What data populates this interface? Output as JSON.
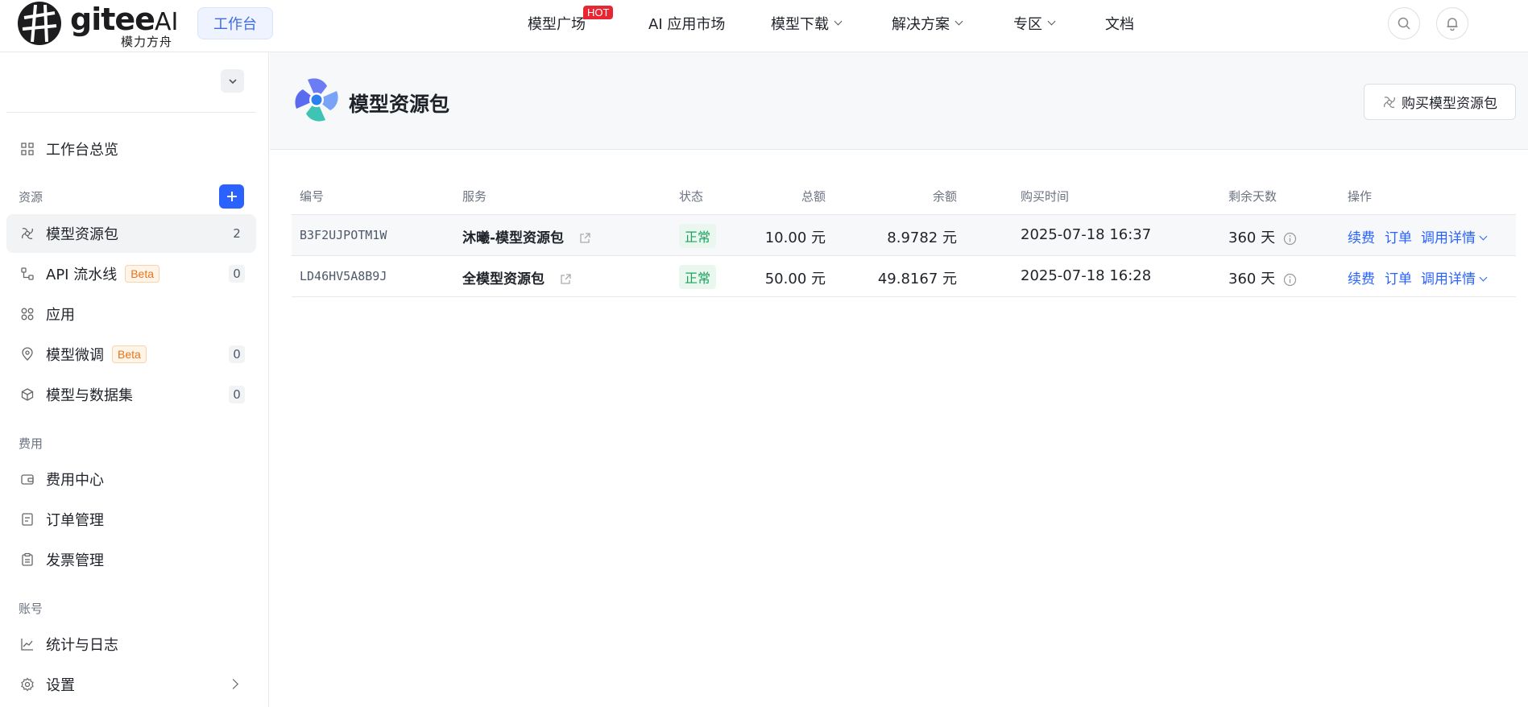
{
  "header": {
    "logo_text": "gitee",
    "logo_ai": "AI",
    "logo_subtitle": "模力方舟",
    "workspace_button": "工作台",
    "nav": [
      {
        "label": "模型广场",
        "badge": "HOT"
      },
      {
        "label": "AI 应用市场"
      },
      {
        "label": "模型下载",
        "dropdown": true
      },
      {
        "label": "解决方案",
        "dropdown": true
      },
      {
        "label": "专区",
        "dropdown": true
      },
      {
        "label": "文档"
      }
    ],
    "search_icon": "search-icon",
    "bell_icon": "bell-icon"
  },
  "sidebar": {
    "overview": "工作台总览",
    "sections": {
      "resources": "资源",
      "billing": "费用",
      "account": "账号"
    },
    "items": [
      {
        "label": "模型资源包",
        "count": "2",
        "icon": "pinwheel-icon"
      },
      {
        "label": "API 流水线",
        "badge": "Beta",
        "count": "0",
        "icon": "pipeline-icon"
      },
      {
        "label": "应用",
        "icon": "apps-icon"
      },
      {
        "label": "模型微调",
        "badge": "Beta",
        "count": "0",
        "icon": "location-pin-icon"
      },
      {
        "label": "模型与数据集",
        "count": "0",
        "icon": "cube-icon"
      },
      {
        "label": "费用中心",
        "icon": "wallet-icon"
      },
      {
        "label": "订单管理",
        "icon": "order-icon"
      },
      {
        "label": "发票管理",
        "icon": "invoice-icon"
      },
      {
        "label": "统计与日志",
        "icon": "chart-line-icon"
      },
      {
        "label": "设置",
        "icon": "gear-icon"
      }
    ]
  },
  "main": {
    "title": "模型资源包",
    "buy_button": "购买模型资源包",
    "table": {
      "columns": [
        "编号",
        "服务",
        "状态",
        "总额",
        "余额",
        "购买时间",
        "剩余天数",
        "操作"
      ],
      "rows": [
        {
          "id": "B3F2UJPOTM1W",
          "service": "沐曦-模型资源包",
          "status": "正常",
          "total": "10.00 元",
          "balance": "8.9782 元",
          "purchased": "2025-07-18 16:37",
          "days_left": "360 天",
          "actions": [
            "续费",
            "订单",
            "调用详情"
          ]
        },
        {
          "id": "LD46HV5A8B9J",
          "service": "全模型资源包",
          "status": "正常",
          "total": "50.00 元",
          "balance": "49.8167 元",
          "purchased": "2025-07-18 16:28",
          "days_left": "360 天",
          "actions": [
            "续费",
            "订单",
            "调用详情"
          ]
        }
      ]
    }
  },
  "colors": {
    "accent": "#2962ff",
    "status_ok": "#1aa35e",
    "hot_badge": "#e82633",
    "beta_badge": "#e5731b"
  }
}
